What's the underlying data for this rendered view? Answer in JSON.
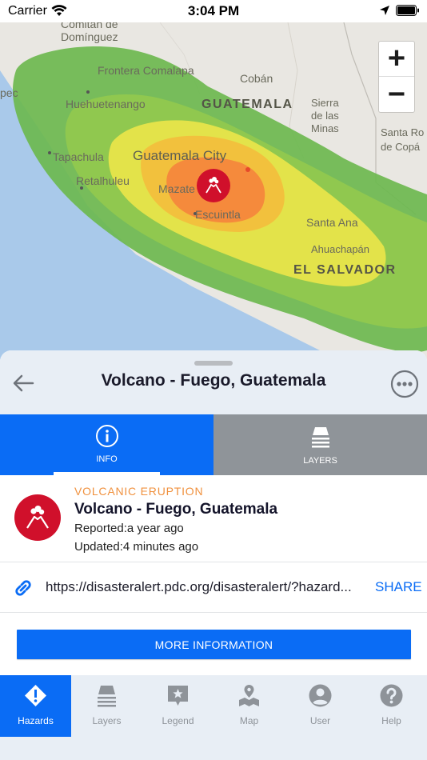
{
  "status_bar": {
    "carrier": "Carrier",
    "time": "3:04 PM"
  },
  "map": {
    "labels": {
      "comitan": "Comitán de",
      "comitan2": "Domínguez",
      "frontera": "Frontera Comalapa",
      "coban": "Cobán",
      "huehuetenango": "Huehuetenango",
      "guatemala_country": "GUATEMALA",
      "sierra": "Sierra",
      "de_las": "de las",
      "minas": "Minas",
      "tapachula": "Tapachula",
      "guatemala_city": "Guatemala City",
      "retalhuleu": "Retalhuleu",
      "mazatenango": "Mazate",
      "escuintla": "Escuintla",
      "santa_rosa": "Santa Ro",
      "de_copan": "de Copá",
      "santa_ana": "Santa Ana",
      "ahuachapan": "Ahuachapán",
      "el_salvador": "EL SALVADOR",
      "pec": "pec",
      "s": "S"
    },
    "zoom_in_label": "+",
    "zoom_out_label": "−",
    "marker_icon": "volcano-icon"
  },
  "sheet": {
    "title": "Volcano - Fuego, Guatemala",
    "tabs": [
      {
        "label": "INFO",
        "icon": "info-icon",
        "active": true
      },
      {
        "label": "LAYERS",
        "icon": "layers-icon",
        "active": false
      }
    ],
    "event": {
      "category": "VOLCANIC ERUPTION",
      "title": "Volcano - Fuego, Guatemala",
      "reported": "Reported:a year ago",
      "updated": "Updated:4 minutes ago",
      "icon": "volcano-icon"
    },
    "link": {
      "url": "https://disasteralert.pdc.org/disasteralert/?hazard...",
      "share_label": "SHARE"
    },
    "more_info_label": "MORE INFORMATION"
  },
  "bottom_nav": [
    {
      "label": "Hazards",
      "icon": "hazard-warning-icon",
      "active": true
    },
    {
      "label": "Layers",
      "icon": "layers-icon",
      "active": false
    },
    {
      "label": "Legend",
      "icon": "legend-icon",
      "active": false
    },
    {
      "label": "Map",
      "icon": "map-icon",
      "active": false
    },
    {
      "label": "User",
      "icon": "user-icon",
      "active": false
    },
    {
      "label": "Help",
      "icon": "help-icon",
      "active": false
    }
  ],
  "colors": {
    "accent": "#0a6cf5",
    "hazard_red": "#d0102b",
    "category_orange": "#f0913e",
    "tab_inactive": "#8f9499",
    "zone_outer": "#6cb94f",
    "zone_green": "#90c84f",
    "zone_yellow": "#e3e34a",
    "zone_amber": "#f2c13d",
    "zone_core": "#f58a3c"
  }
}
